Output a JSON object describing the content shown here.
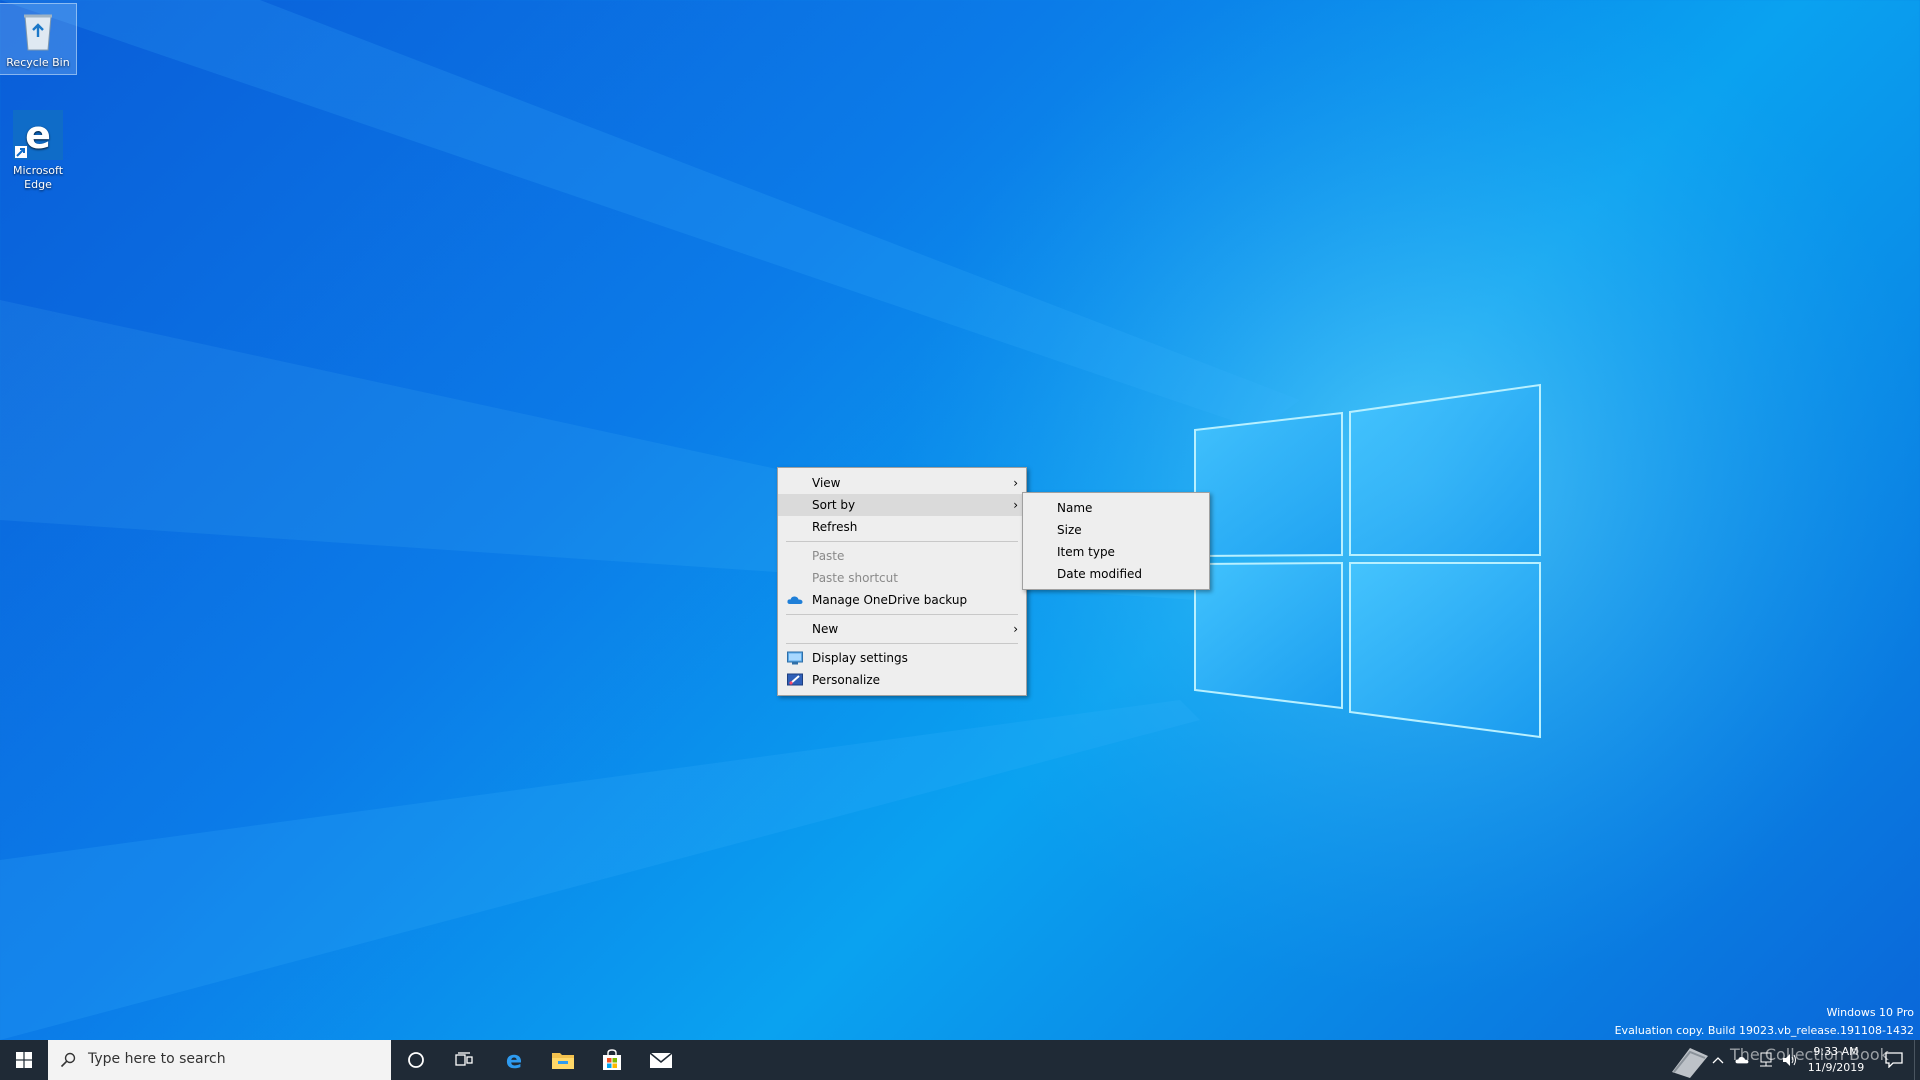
{
  "desktop": {
    "icons": [
      {
        "label": "Recycle Bin",
        "icon": "recycle-bin-icon"
      },
      {
        "label": "Microsoft Edge",
        "icon": "edge-icon"
      }
    ]
  },
  "context_menu": {
    "items": [
      {
        "label": "View",
        "has_submenu": true
      },
      {
        "label": "Sort by",
        "has_submenu": true,
        "highlighted": true
      },
      {
        "label": "Refresh"
      },
      {
        "label": "Paste",
        "disabled": true
      },
      {
        "label": "Paste shortcut",
        "disabled": true
      },
      {
        "label": "Manage OneDrive backup",
        "icon": "onedrive-icon"
      },
      {
        "label": "New",
        "has_submenu": true
      },
      {
        "label": "Display settings",
        "icon": "display-icon"
      },
      {
        "label": "Personalize",
        "icon": "personalize-icon"
      }
    ],
    "arrow_glyph": "›"
  },
  "sort_submenu": {
    "items": [
      {
        "label": "Name"
      },
      {
        "label": "Size"
      },
      {
        "label": "Item type"
      },
      {
        "label": "Date modified"
      }
    ]
  },
  "watermark": {
    "edition": "Windows 10 Pro",
    "build": "Evaluation copy. Build 19023.vb_release.191108-1432"
  },
  "taskbar": {
    "search_placeholder": "Type here to search",
    "pinned": [
      "cortana-icon",
      "task-view-icon",
      "edge-icon",
      "file-explorer-icon",
      "store-icon",
      "mail-icon"
    ],
    "clock_time": "9:33 AM",
    "clock_date": "11/9/2019",
    "overlay_text": "The Collection Book"
  },
  "colors": {
    "taskbar": "#1f2a36",
    "menu_bg": "#eeeeee",
    "menu_highlight": "#dadada",
    "accent": "#0078d7"
  }
}
